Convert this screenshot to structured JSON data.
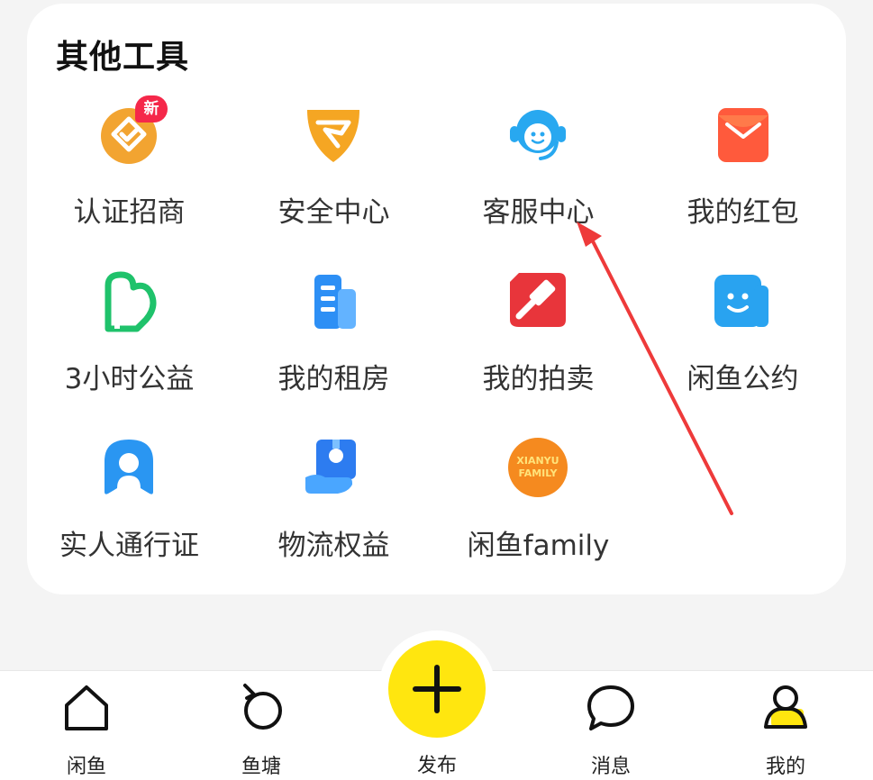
{
  "section": {
    "title": "其他工具"
  },
  "tools": [
    {
      "label": "认证招商",
      "icon": "certified-merchant-icon",
      "badge": "新"
    },
    {
      "label": "安全中心",
      "icon": "shield-icon"
    },
    {
      "label": "客服中心",
      "icon": "customer-service-icon"
    },
    {
      "label": "我的红包",
      "icon": "red-envelope-icon"
    },
    {
      "label": "3小时公益",
      "icon": "charity-icon"
    },
    {
      "label": "我的租房",
      "icon": "building-icon"
    },
    {
      "label": "我的拍卖",
      "icon": "auction-hammer-icon"
    },
    {
      "label": "闲鱼公约",
      "icon": "smile-card-icon"
    },
    {
      "label": "实人通行证",
      "icon": "person-badge-icon"
    },
    {
      "label": "物流权益",
      "icon": "logistics-box-icon"
    },
    {
      "label": "闲鱼family",
      "icon": "xianyu-family-logo",
      "logo_text": [
        "XIANYU",
        "FAMILY"
      ]
    }
  ],
  "tabbar": {
    "items": [
      {
        "label": "闲鱼",
        "icon": "home-icon"
      },
      {
        "label": "鱼塘",
        "icon": "fish-pond-icon"
      },
      {
        "label": "发布",
        "icon": "plus-icon"
      },
      {
        "label": "消息",
        "icon": "message-bubble-icon"
      },
      {
        "label": "我的",
        "icon": "profile-icon"
      }
    ]
  },
  "colors": {
    "accent_yellow": "#ffe60f",
    "arrow_red": "#ee3a3a",
    "badge_red": "#f5284a"
  }
}
